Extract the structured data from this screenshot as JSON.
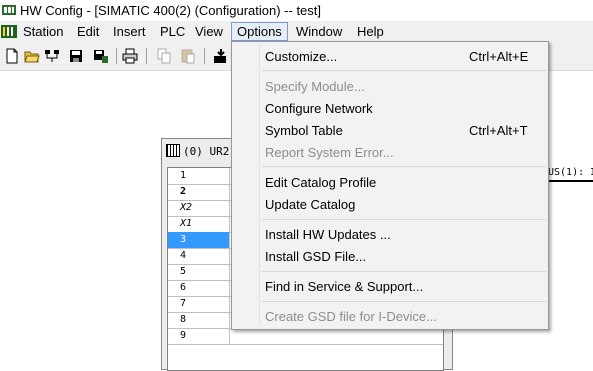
{
  "window": {
    "title": "HW Config - [SIMATIC 400(2) (Configuration) -- test]"
  },
  "menubar": {
    "items": [
      "Station",
      "Edit",
      "Insert",
      "PLC",
      "View",
      "Options",
      "Window",
      "Help"
    ],
    "active": "Options"
  },
  "toolbar": {
    "icons": [
      "new-icon",
      "open-icon",
      "network-open-icon",
      "save-icon",
      "save-compile-icon",
      "print-icon",
      "copy-icon",
      "paste-icon",
      "download-icon"
    ]
  },
  "rack": {
    "title": "(0) UR2",
    "slots": [
      "1",
      "2",
      "X2",
      "X1",
      "3",
      "4",
      "5",
      "6",
      "7",
      "8",
      "9"
    ],
    "selected_slot": "3"
  },
  "network": {
    "label": "US(1): I"
  },
  "options_menu": {
    "items": [
      {
        "label": "Customize...",
        "shortcut": "Ctrl+Alt+E",
        "enabled": true
      },
      {
        "label": "Specify Module...",
        "shortcut": "",
        "enabled": false
      },
      {
        "label": "Configure Network",
        "shortcut": "",
        "enabled": true
      },
      {
        "label": "Symbol Table",
        "shortcut": "Ctrl+Alt+T",
        "enabled": true
      },
      {
        "label": "Report System Error...",
        "shortcut": "",
        "enabled": false
      },
      {
        "label": "Edit Catalog Profile",
        "shortcut": "",
        "enabled": true
      },
      {
        "label": "Update Catalog",
        "shortcut": "",
        "enabled": true
      },
      {
        "label": "Install HW Updates ...",
        "shortcut": "",
        "enabled": true
      },
      {
        "label": "Install GSD File...",
        "shortcut": "",
        "enabled": true
      },
      {
        "label": "Find in Service & Support...",
        "shortcut": "",
        "enabled": true
      },
      {
        "label": "Create GSD file for I-Device...",
        "shortcut": "",
        "enabled": false
      }
    ]
  },
  "colors": {
    "selection": "#3399ff",
    "menu_background": "#f2f2f2",
    "disabled_text": "#8d8d8d"
  }
}
